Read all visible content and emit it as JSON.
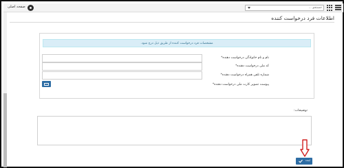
{
  "header": {
    "search_placeholder": "جستجو ...",
    "home_label": "صفحه اصلی"
  },
  "page": {
    "title": "اطلاعات فرد درخواست کننده"
  },
  "form": {
    "info_message": "مشخصات فرد درخواست کننده از طریق ذیل درج شود.",
    "fields": [
      {
        "label": "نام و نام خانوادگی درخواست دهنده*",
        "value": ""
      },
      {
        "label": "کد ملی درخواست دهنده*",
        "value": ""
      },
      {
        "label": "شماره تلفن همراه درخواست دهنده*",
        "value": ""
      },
      {
        "label": "پیوست تصویر کارت ملی درخواست دهنده*"
      }
    ]
  },
  "description": {
    "label": "توضیحات:",
    "value": ""
  },
  "actions": {
    "submit_label": "ثبت"
  },
  "colors": {
    "primary": "#2e6da4",
    "info_bg": "#d9edf7",
    "info_text": "#31708f",
    "arrow": "#d11f1f"
  }
}
